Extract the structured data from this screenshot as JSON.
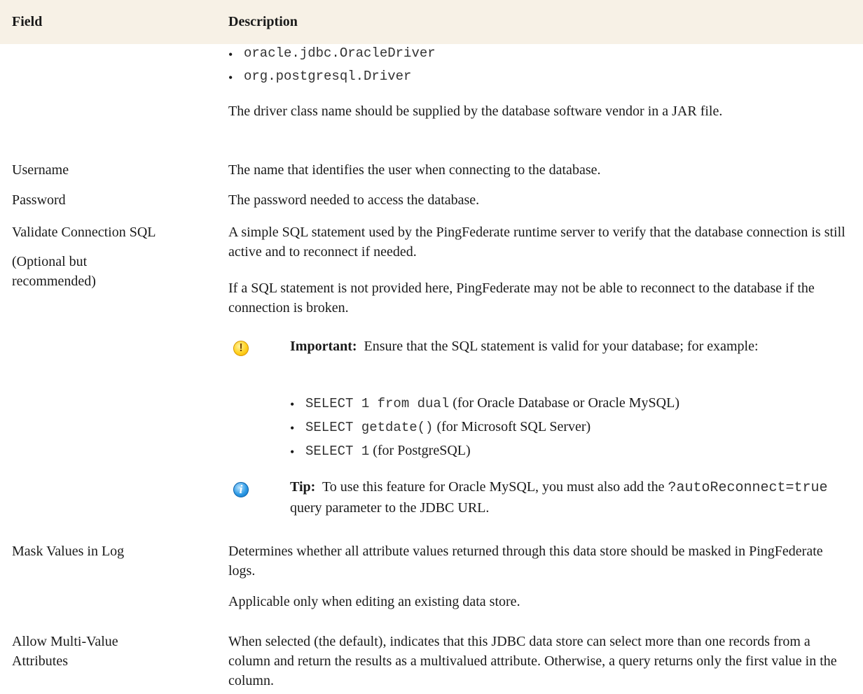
{
  "header": {
    "field": "Field",
    "description": "Description"
  },
  "rows": {
    "driver": {
      "bullets": [
        "oracle.jdbc.OracleDriver",
        "org.postgresql.Driver"
      ],
      "text": "The driver class name should be supplied by the database software vendor in a JAR file."
    },
    "username": {
      "field": "Username",
      "text": "The name that identifies the user when connecting to the database."
    },
    "password": {
      "field": "Password",
      "text": "The password needed to access the database."
    },
    "validate": {
      "field": "Validate Connection SQL",
      "field_note": "(Optional but recommended)",
      "text1": "A simple SQL statement used by the PingFederate runtime server to verify that the database connection is still active and to reconnect if needed.",
      "text2": "If a SQL statement is not provided here, PingFederate may not be able to reconnect to the database if the connection is broken.",
      "important_label": "Important:",
      "important_text": "Ensure that the SQL statement is valid for your database; for example:",
      "examples": [
        {
          "code": "SELECT 1 from dual",
          "note": " (for Oracle Database or Oracle MySQL)"
        },
        {
          "code": "SELECT getdate()",
          "note": " (for Microsoft SQL Server)"
        },
        {
          "code": "SELECT 1",
          "note": " (for PostgreSQL)"
        }
      ],
      "tip_label": "Tip:",
      "tip_text": "To use this feature for Oracle MySQL, you must also add the",
      "tip_code": "?autoReconnect=true",
      "tip_text_end": " query parameter to the JDBC URL."
    },
    "mask": {
      "field": "Mask Values in Log",
      "text1": "Determines whether all attribute values returned through this data store should be masked in PingFederate logs.",
      "text2": "Applicable only when editing an existing data store."
    },
    "multi": {
      "field": "Allow Multi-Value Attributes",
      "text": "When selected (the default), indicates that this JDBC data store can select more than one records from a column and return the results as a multivalued attribute. Otherwise, a query returns only the first value in the column."
    }
  },
  "icons": {
    "important": "important-icon",
    "tip": "info-icon"
  }
}
